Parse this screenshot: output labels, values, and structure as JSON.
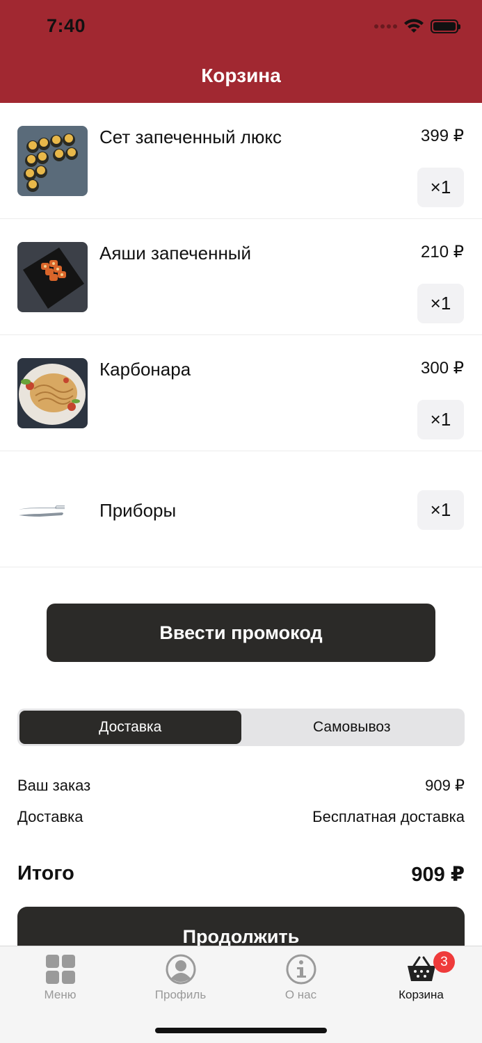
{
  "status_bar": {
    "time": "7:40",
    "icons": [
      "signal-icon",
      "wifi-icon",
      "battery-icon"
    ]
  },
  "header": {
    "title": "Корзина"
  },
  "cart": {
    "items": [
      {
        "name": "Сет запеченный люкс",
        "price": "399 ₽",
        "quantity": "×1",
        "image": "baked-sushi-set-photo"
      },
      {
        "name": "Аяши запеченный",
        "price": "210 ₽",
        "quantity": "×1",
        "image": "baked-roll-photo"
      },
      {
        "name": "Карбонара",
        "price": "300 ₽",
        "quantity": "×1",
        "image": "carbonara-pasta-photo"
      }
    ],
    "utensils": {
      "name": "Приборы",
      "quantity": "×1",
      "icon": "fork-knife-icon"
    }
  },
  "promo_button": "Ввести промокод",
  "delivery_toggle": {
    "options": [
      "Доставка",
      "Самовывоз"
    ],
    "selected": "Доставка"
  },
  "summary": {
    "order_label": "Ваш заказ",
    "order_value": "909 ₽",
    "delivery_label": "Доставка",
    "delivery_value": "Бесплатная доставка",
    "total_label": "Итого",
    "total_value": "909 ₽"
  },
  "continue_button": "Продолжить",
  "tabbar": {
    "tabs": [
      {
        "label": "Меню",
        "icon": "grid-icon"
      },
      {
        "label": "Профиль",
        "icon": "profile-icon"
      },
      {
        "label": "О нас",
        "icon": "info-icon"
      },
      {
        "label": "Корзина",
        "icon": "basket-icon",
        "badge": "3",
        "active": true
      }
    ]
  },
  "colors": {
    "brand_red": "#a12831",
    "dark_button": "#2b2a28",
    "badge": "#ef3b3b"
  }
}
